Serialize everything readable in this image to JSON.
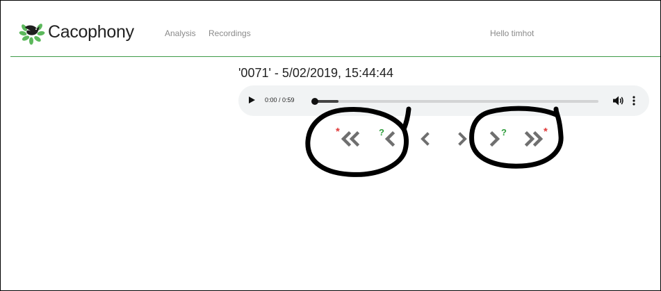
{
  "navbar": {
    "brand": "Cacophony",
    "links": [
      {
        "label": "Analysis"
      },
      {
        "label": "Recordings"
      }
    ],
    "greeting": "Hello timhot"
  },
  "recording": {
    "title": "'0071' - 5/02/2019, 15:44:44"
  },
  "player": {
    "time": "0:00 / 0:59",
    "progress": 0.0
  },
  "navigation": {
    "first_badge": "*",
    "prev_untagged_badge": "?",
    "next_untagged_badge": "?",
    "last_badge": "*"
  },
  "colors": {
    "brand_green": "#3d9a47",
    "nav_text": "#8a8a8a",
    "nav_arrow": "#6f6f6f",
    "badge_red": "#e03a3a",
    "badge_green": "#2f9d3c",
    "player_bg": "#f1f3f4",
    "marker": "#000000"
  },
  "icons": [
    "cacophony-bird-logo",
    "play-icon",
    "volume-icon",
    "more-options-icon",
    "double-chevron-left-icon",
    "chevron-left-icon",
    "chevron-right-icon",
    "double-chevron-right-icon"
  ]
}
